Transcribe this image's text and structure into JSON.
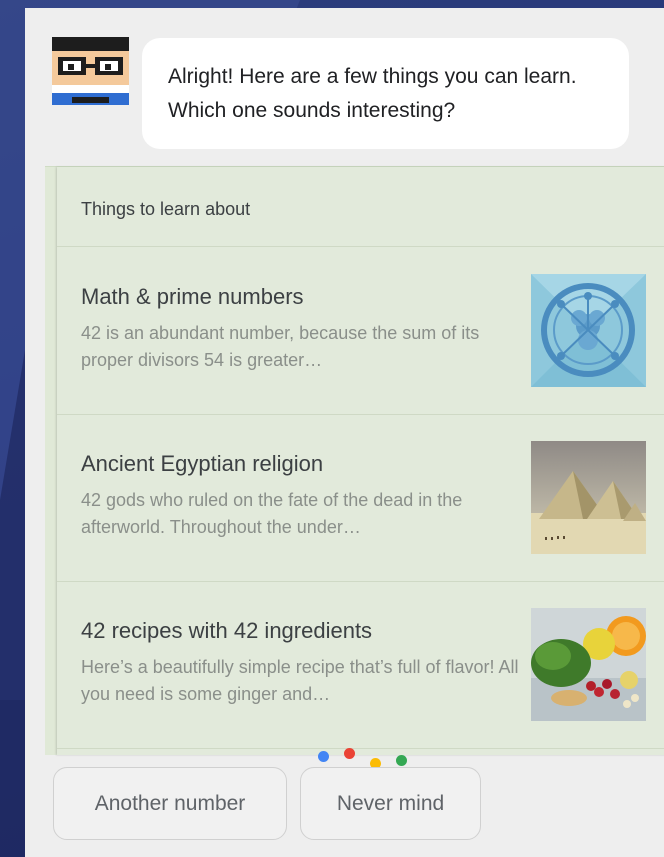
{
  "assistant": {
    "message": "Alright! Here are a few things you can learn. Which one sounds interesting?"
  },
  "card": {
    "header": "Things to learn about",
    "items": [
      {
        "title": "Math & prime numbers",
        "description": "42 is an abundant number, because the sum of its proper divisors 54 is greater…",
        "thumbnail_icon": "network-diagram-icon"
      },
      {
        "title": "Ancient Egyptian religion",
        "description": "42 gods who ruled on the fate of the dead in the afterworld. Throughout the under…",
        "thumbnail_icon": "pyramids-image"
      },
      {
        "title": "42 recipes with 42 ingredients",
        "description": "Here’s a beautifully simple recipe that’s full of flavor! All you need is some ginger and…",
        "thumbnail_icon": "ingredients-image"
      }
    ]
  },
  "suggestions": [
    {
      "label": "Another number"
    },
    {
      "label": "Never mind"
    }
  ],
  "colors": {
    "background": "#2a3a78",
    "panel": "#eeeeee",
    "card": "#e2eadb",
    "dot_blue": "#4285f4",
    "dot_red": "#ea4335",
    "dot_yellow": "#fbbc05",
    "dot_green": "#34a853"
  }
}
